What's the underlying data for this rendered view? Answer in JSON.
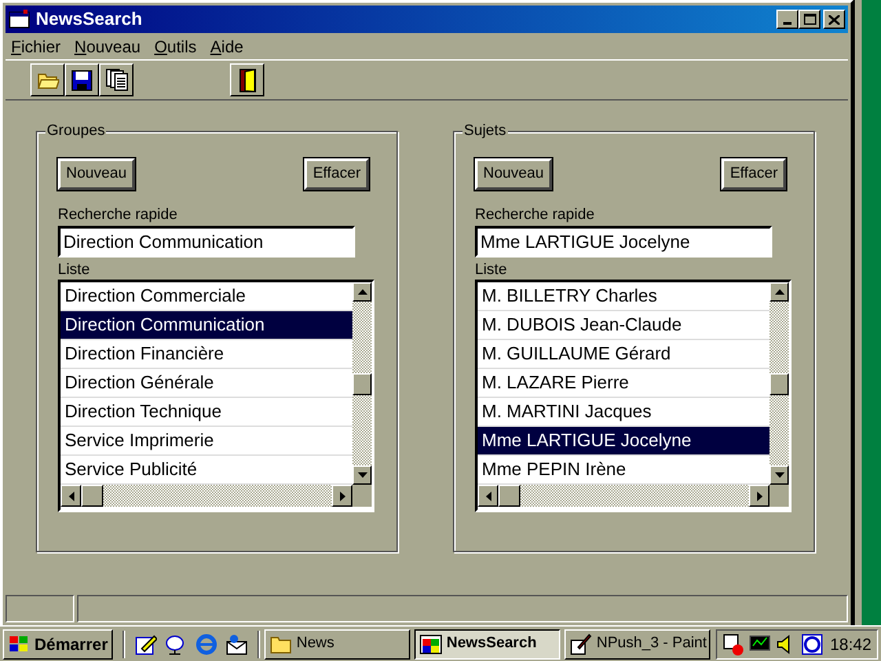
{
  "window": {
    "title": "NewsSearch"
  },
  "menu": [
    "Fichier",
    "Nouveau",
    "Outils",
    "Aide"
  ],
  "panels": [
    {
      "title": "Groupes",
      "buttons": [
        "Nouveau",
        "Effacer"
      ],
      "search_label": "Recherche rapide",
      "search_value": "Direction Communication",
      "list_label": "Liste",
      "items": [
        {
          "label": "Direction Commerciale",
          "selected": false
        },
        {
          "label": "Direction Communication",
          "selected": true
        },
        {
          "label": "Direction Financière",
          "selected": false
        },
        {
          "label": "Direction Générale",
          "selected": false
        },
        {
          "label": "Direction Technique",
          "selected": false
        },
        {
          "label": "Service Imprimerie",
          "selected": false
        },
        {
          "label": "Service Publicité",
          "selected": false
        }
      ]
    },
    {
      "title": "Sujets",
      "buttons": [
        "Nouveau",
        "Effacer"
      ],
      "search_label": "Recherche rapide",
      "search_value": "Mme LARTIGUE Jocelyne",
      "list_label": "Liste",
      "items": [
        {
          "label": "M. BILLETRY Charles",
          "selected": false
        },
        {
          "label": "M. DUBOIS Jean-Claude",
          "selected": false
        },
        {
          "label": "M. GUILLAUME Gérard",
          "selected": false
        },
        {
          "label": "M. LAZARE Pierre",
          "selected": false
        },
        {
          "label": "M. MARTINI Jacques",
          "selected": false
        },
        {
          "label": "Mme LARTIGUE Jocelyne",
          "selected": true
        },
        {
          "label": "Mme PEPIN Irène",
          "selected": false
        }
      ]
    }
  ],
  "taskbar": {
    "start": "Démarrer",
    "tasks": [
      {
        "label": "News",
        "selected": false
      },
      {
        "label": "NewsSearch",
        "selected": true
      },
      {
        "label": "NPush_3 - Paint",
        "selected": false
      }
    ],
    "clock": "18:42"
  }
}
